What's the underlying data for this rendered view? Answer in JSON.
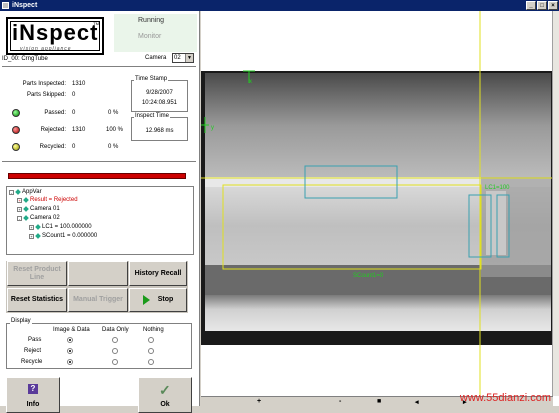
{
  "window": {
    "title": "iNspect"
  },
  "logo": {
    "text": "iNspect",
    "tm": "TM",
    "subtitle": "vision appliance"
  },
  "status": {
    "running": "Running",
    "monitor": "Monitor"
  },
  "camera": {
    "label": "Camera",
    "value": "02"
  },
  "job": {
    "name": "ID_00: CrngTube"
  },
  "stats": {
    "parts_inspected_label": "Parts Inspected:",
    "parts_inspected": "1310",
    "parts_skipped_label": "Parts Skipped:",
    "parts_skipped": "0",
    "passed_label": "Passed:",
    "passed": "0",
    "passed_pct": "0 %",
    "rejected_label": "Rejected:",
    "rejected": "1310",
    "rejected_pct": "100 %",
    "recycled_label": "Recycled:",
    "recycled": "0",
    "recycled_pct": "0 %"
  },
  "timestamp": {
    "title": "Time Stamp",
    "date": "9/28/2007",
    "time": "10:24:08.951"
  },
  "inspect_time": {
    "title": "Inspect Time",
    "value": "12.968 ms"
  },
  "tree": {
    "items": [
      {
        "label": "AppVar",
        "exp": "-"
      },
      {
        "label": "Result = Rejected",
        "exp": "+"
      },
      {
        "label": "Camera 01",
        "exp": "+"
      },
      {
        "label": "Camera 02",
        "exp": "-"
      },
      {
        "label": "LC1 = 100.000000",
        "exp": "+"
      },
      {
        "label": "SCount1 = 0.000000",
        "exp": "+"
      }
    ]
  },
  "buttons": {
    "reset_product": "Reset Product Line",
    "history_recall": "History Recall",
    "reset_statistics": "Reset Statistics",
    "manual_trigger": "Manual Trigger",
    "stop": "Stop",
    "info": "Info",
    "ok": "Ok"
  },
  "display": {
    "title": "Display",
    "headers": [
      "Image & Data",
      "Data Only",
      "Nothing"
    ],
    "rows": [
      {
        "label": "Pass",
        "selected": 0
      },
      {
        "label": "Reject",
        "selected": 0
      },
      {
        "label": "Recycle",
        "selected": 0
      }
    ]
  },
  "image": {
    "axis_y": "y",
    "axis_x": "x",
    "lc_label": "LC1=100",
    "scount_label": "SCount1=0"
  },
  "hscroll": {
    "ticks": [
      "+",
      "-",
      "■",
      "◂",
      "▸"
    ]
  },
  "watermark": "www.55dianzi.com",
  "colors": {
    "overlay_green": "#22cc22",
    "overlay_yellow": "#e0e020",
    "overlay_cyan": "#3aa0b0",
    "reject_red": "#cc0000"
  }
}
